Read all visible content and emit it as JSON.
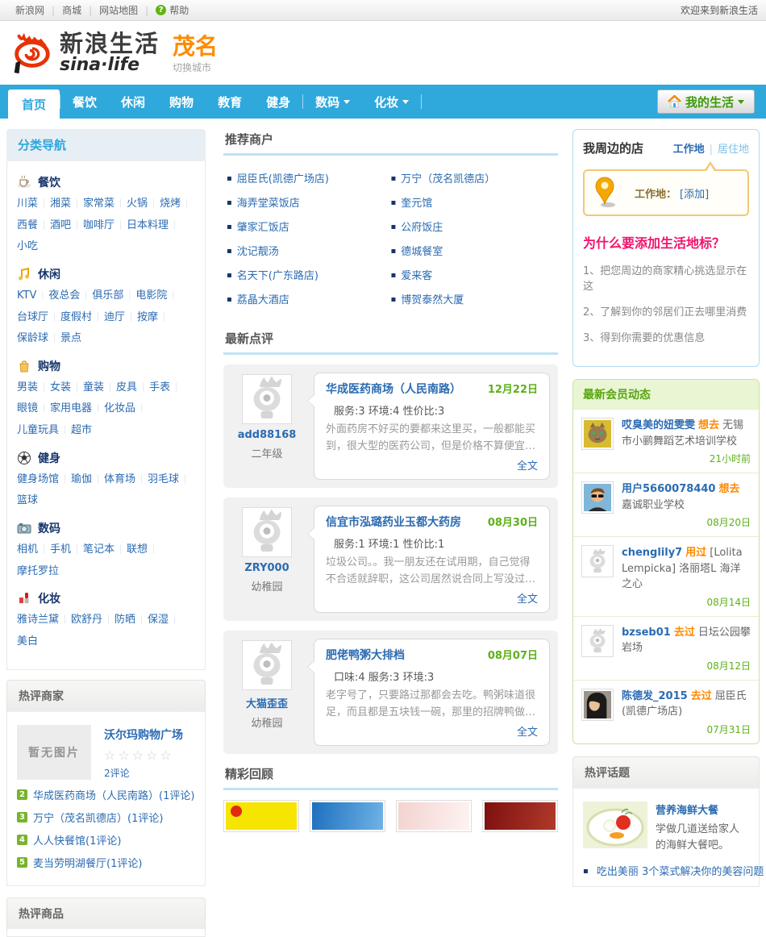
{
  "topbar": {
    "links": [
      "新浪网",
      "商城",
      "网站地图",
      "帮助"
    ],
    "help_glyph": "?",
    "welcome": "欢迎来到新浪生活"
  },
  "header": {
    "brand_cn": "新浪生活",
    "brand_en": "sina·life",
    "city": "茂名",
    "switch_city": "切换城市"
  },
  "nav": {
    "items": [
      "首页",
      "餐饮",
      "休闲",
      "购物",
      "教育",
      "健身",
      "数码",
      "化妆"
    ],
    "my_life": "我的生活"
  },
  "category_nav": {
    "title": "分类导航",
    "groups": [
      {
        "icon": "food-icon",
        "name": "餐饮",
        "links": [
          "川菜",
          "湘菜",
          "家常菜",
          "火锅",
          "烧烤",
          "西餐",
          "酒吧",
          "咖啡厅",
          "日本料理",
          "小吃"
        ]
      },
      {
        "icon": "leisure-icon",
        "name": "休闲",
        "links": [
          "KTV",
          "夜总会",
          "俱乐部",
          "电影院",
          "台球厅",
          "度假村",
          "迪厅",
          "按摩",
          "保龄球",
          "景点"
        ]
      },
      {
        "icon": "shopping-icon",
        "name": "购物",
        "links": [
          "男装",
          "女装",
          "童装",
          "皮具",
          "手表",
          "眼镜",
          "家用电器",
          "化妆品",
          "儿童玩具",
          "超市"
        ]
      },
      {
        "icon": "fitness-icon",
        "name": "健身",
        "links": [
          "健身场馆",
          "瑜伽",
          "体育场",
          "羽毛球",
          "篮球"
        ]
      },
      {
        "icon": "digital-icon",
        "name": "数码",
        "links": [
          "相机",
          "手机",
          "笔记本",
          "联想",
          "摩托罗拉"
        ]
      },
      {
        "icon": "cosmetics-icon",
        "name": "化妆",
        "links": [
          "雅诗兰黛",
          "欧舒丹",
          "防晒",
          "保湿",
          "美白"
        ]
      }
    ]
  },
  "hot_merchants": {
    "title": "热评商家",
    "featured": {
      "no_image": "暂无图片",
      "name": "沃尔玛购物广场",
      "stars": "☆☆☆☆☆",
      "review_count": "2评论"
    },
    "list": [
      {
        "rank": "2",
        "name": "华成医药商场（人民南路）",
        "count": "(1评论)"
      },
      {
        "rank": "3",
        "name": "万宁（茂名凯德店）",
        "count": "(1评论)"
      },
      {
        "rank": "4",
        "name": "人人快餐馆",
        "count": "(1评论)"
      },
      {
        "rank": "5",
        "name": "麦当劳明湖餐厅",
        "count": "(1评论)"
      }
    ]
  },
  "hot_products": {
    "title": "热评商品"
  },
  "recommended": {
    "title": "推荐商户",
    "col1": [
      "屈臣氏(凯德广场店)",
      "海弄堂菜饭店",
      "肇家汇饭店",
      "沈记靓汤",
      "名天下(广东路店)",
      "荔晶大酒店"
    ],
    "col2": [
      "万宁（茂名凯德店）",
      "奎元馆",
      "公府饭庄",
      "德城餐室",
      "爱来客",
      "博贺泰然大厦"
    ]
  },
  "latest_reviews": {
    "title": "最新点评",
    "items": [
      {
        "user": "add88168",
        "level": "二年级",
        "shop": "华成医药商场（人民南路）",
        "date": "12月22日",
        "ratings": "服务:3 环境:4 性价比:3",
        "text": "外面药房不好买的要都来这里买，一般都能买到，很大型的医药公司，但是价格不算便宜…",
        "more": "全文"
      },
      {
        "user": "ZRY000",
        "level": "幼稚园",
        "shop": "信宜市泓璐药业玉都大药房",
        "date": "08月30日",
        "ratings": "服务:1 环境:1 性价比:1",
        "text": "垃圾公司。。我一朋友还在试用期，自己觉得不合适就辞职，这公司居然说合同上写没过…",
        "more": "全文"
      },
      {
        "user": "大猫歪歪",
        "level": "幼稚园",
        "shop": "肥佬鸭粥大排档",
        "date": "08月07日",
        "ratings": "口味:4 服务:3 环境:3",
        "text": "老字号了，只要路过那都会去吃。鸭粥味道很足，而且都是五块钱一碗，那里的招牌鸭做…",
        "more": "全文"
      }
    ]
  },
  "highlights": {
    "title": "精彩回顾"
  },
  "nearby": {
    "title": "我周边的店",
    "tab_work": "工作地",
    "tab_home": "居住地",
    "bubble_label": "工作地：",
    "bubble_add": "[添加]",
    "why_title": "为什么要添加生活地标？",
    "reasons": [
      "1、把您周边的商家精心挑选显示在这",
      "2、了解到你的邻居们正去哪里消费",
      "3、得到你需要的优惠信息"
    ]
  },
  "member_feed": {
    "title": "最新会员动态",
    "items": [
      {
        "user": "哎臭美的妞雯雯",
        "action": "想去",
        "target": "无锡市小鹂舞蹈艺术培训学校",
        "date": "21小时前"
      },
      {
        "user": "用户5660078440",
        "action": "想去",
        "target": "嘉诚职业学校",
        "date": "08月20日"
      },
      {
        "user": "chenglily7",
        "action": "用过",
        "target": "[Lolita Lempicka] 洛丽塔L 海洋之心",
        "date": "08月14日"
      },
      {
        "user": "bzseb01",
        "action": "去过",
        "target": "日坛公园攀岩场",
        "date": "08月12日"
      },
      {
        "user": "陈德发_2015",
        "action": "去过",
        "target": "屈臣氏(凯德广场店)",
        "date": "07月31日"
      }
    ]
  },
  "hot_topics": {
    "title": "热评话题",
    "featured": {
      "name": "营养海鲜大餐",
      "desc": "学做几道送给家人的海鲜大餐吧。"
    },
    "list": [
      "吃出美丽 3个菜式解决你的美容问题"
    ]
  },
  "colors": {
    "nav_blue": "#2fa8dc",
    "link_blue": "#2b6bb2",
    "date_green": "#5eb018",
    "action_orange": "#ff8a00",
    "why_pink": "#f0146e"
  }
}
